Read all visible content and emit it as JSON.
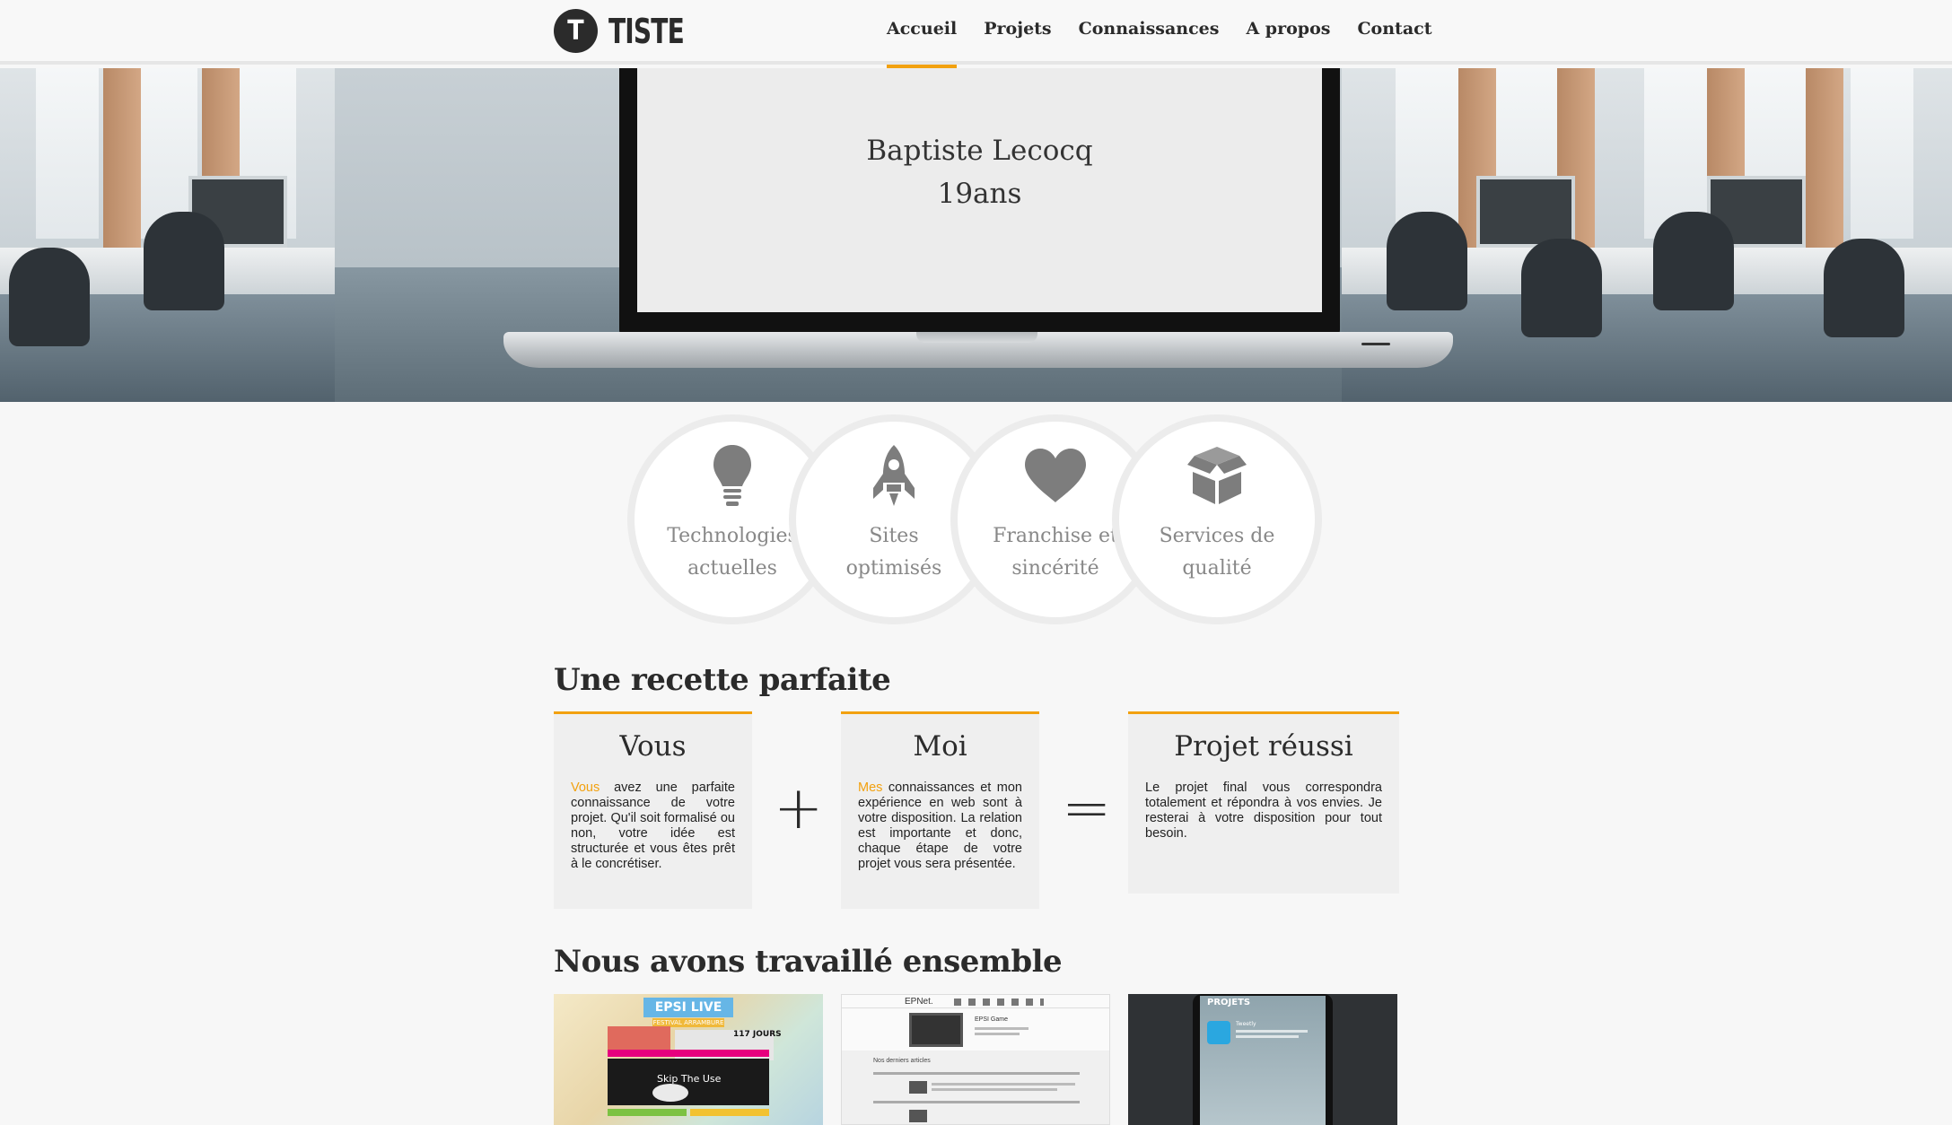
{
  "brand": {
    "letter": "T",
    "name": "TISTE"
  },
  "nav": [
    {
      "label": "Accueil",
      "active": true
    },
    {
      "label": "Projets",
      "active": false
    },
    {
      "label": "Connaissances",
      "active": false
    },
    {
      "label": "A propos",
      "active": false
    },
    {
      "label": "Contact",
      "active": false
    }
  ],
  "hero": {
    "name": "Baptiste Lecocq",
    "age": "19ans"
  },
  "features": [
    {
      "icon": "lightbulb-icon",
      "line1": "Technologies",
      "line2": "actuelles"
    },
    {
      "icon": "rocket-icon",
      "line1": "Sites",
      "line2": "optimisés"
    },
    {
      "icon": "heart-icon",
      "line1": "Franchise et",
      "line2": "sincérité"
    },
    {
      "icon": "box-icon",
      "line1": "Services de",
      "line2": "qualité"
    }
  ],
  "recipe": {
    "heading": "Une recette parfaite",
    "cards": [
      {
        "title": "Vous",
        "highlight": "Vous",
        "text": " avez une parfaite connaissance de votre projet. Qu'il soit formalisé ou non, votre idée est structurée et vous êtes prêt à le concrétiser."
      },
      {
        "title": "Moi",
        "highlight": "Mes",
        "text": " connaissances et mon expérience en web sont à votre disposition. La relation est importante et donc, chaque étape de votre projet vous sera présentée."
      },
      {
        "title": "Projet réussi",
        "highlight": "",
        "text": "Le projet final vous correspondra totalement et répondra à vos envies. Je resterai à votre disposition pour tout besoin."
      }
    ],
    "plus": "+",
    "equals": "="
  },
  "work": {
    "heading": "Nous avons travaillé ensemble",
    "thumb1": {
      "title": "EPSI LIVE",
      "subtitle": "FESTIVAL ARRAMBURE",
      "days": "117 JOURS",
      "band": "Skip The Use"
    },
    "thumb2": {
      "brand": "EPNet.",
      "app": "EPSI Game",
      "section": "Nos derniers articles"
    },
    "thumb3": {
      "header": "PROJETS",
      "item": "Tweetly"
    }
  },
  "colors": {
    "accent": "#f2a10f",
    "dark": "#2b2b2b",
    "background": "#f7f7f7"
  }
}
